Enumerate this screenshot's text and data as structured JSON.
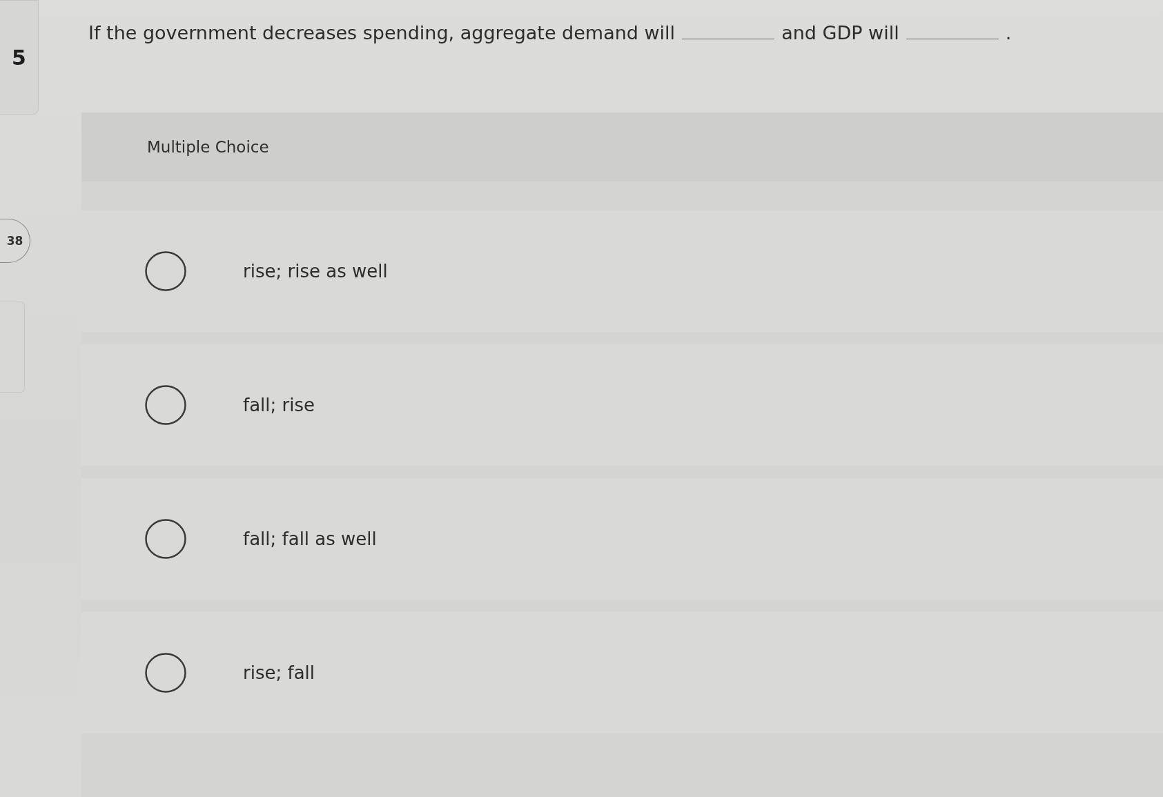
{
  "sidebar": {
    "question_number": "5",
    "points_badge": "38"
  },
  "question": {
    "parts": [
      {
        "kind": "text",
        "text": "If the government decreases spending, aggregate demand will"
      },
      {
        "kind": "blank"
      },
      {
        "kind": "text",
        "text": "and GDP will"
      },
      {
        "kind": "blank"
      },
      {
        "kind": "text",
        "text": "."
      }
    ]
  },
  "answer_panel": {
    "label": "Multiple Choice",
    "options": [
      {
        "text": "rise; rise as well",
        "selected": false
      },
      {
        "text": "fall; rise",
        "selected": false
      },
      {
        "text": "fall; fall as well",
        "selected": false
      },
      {
        "text": "rise; fall",
        "selected": false
      }
    ]
  }
}
